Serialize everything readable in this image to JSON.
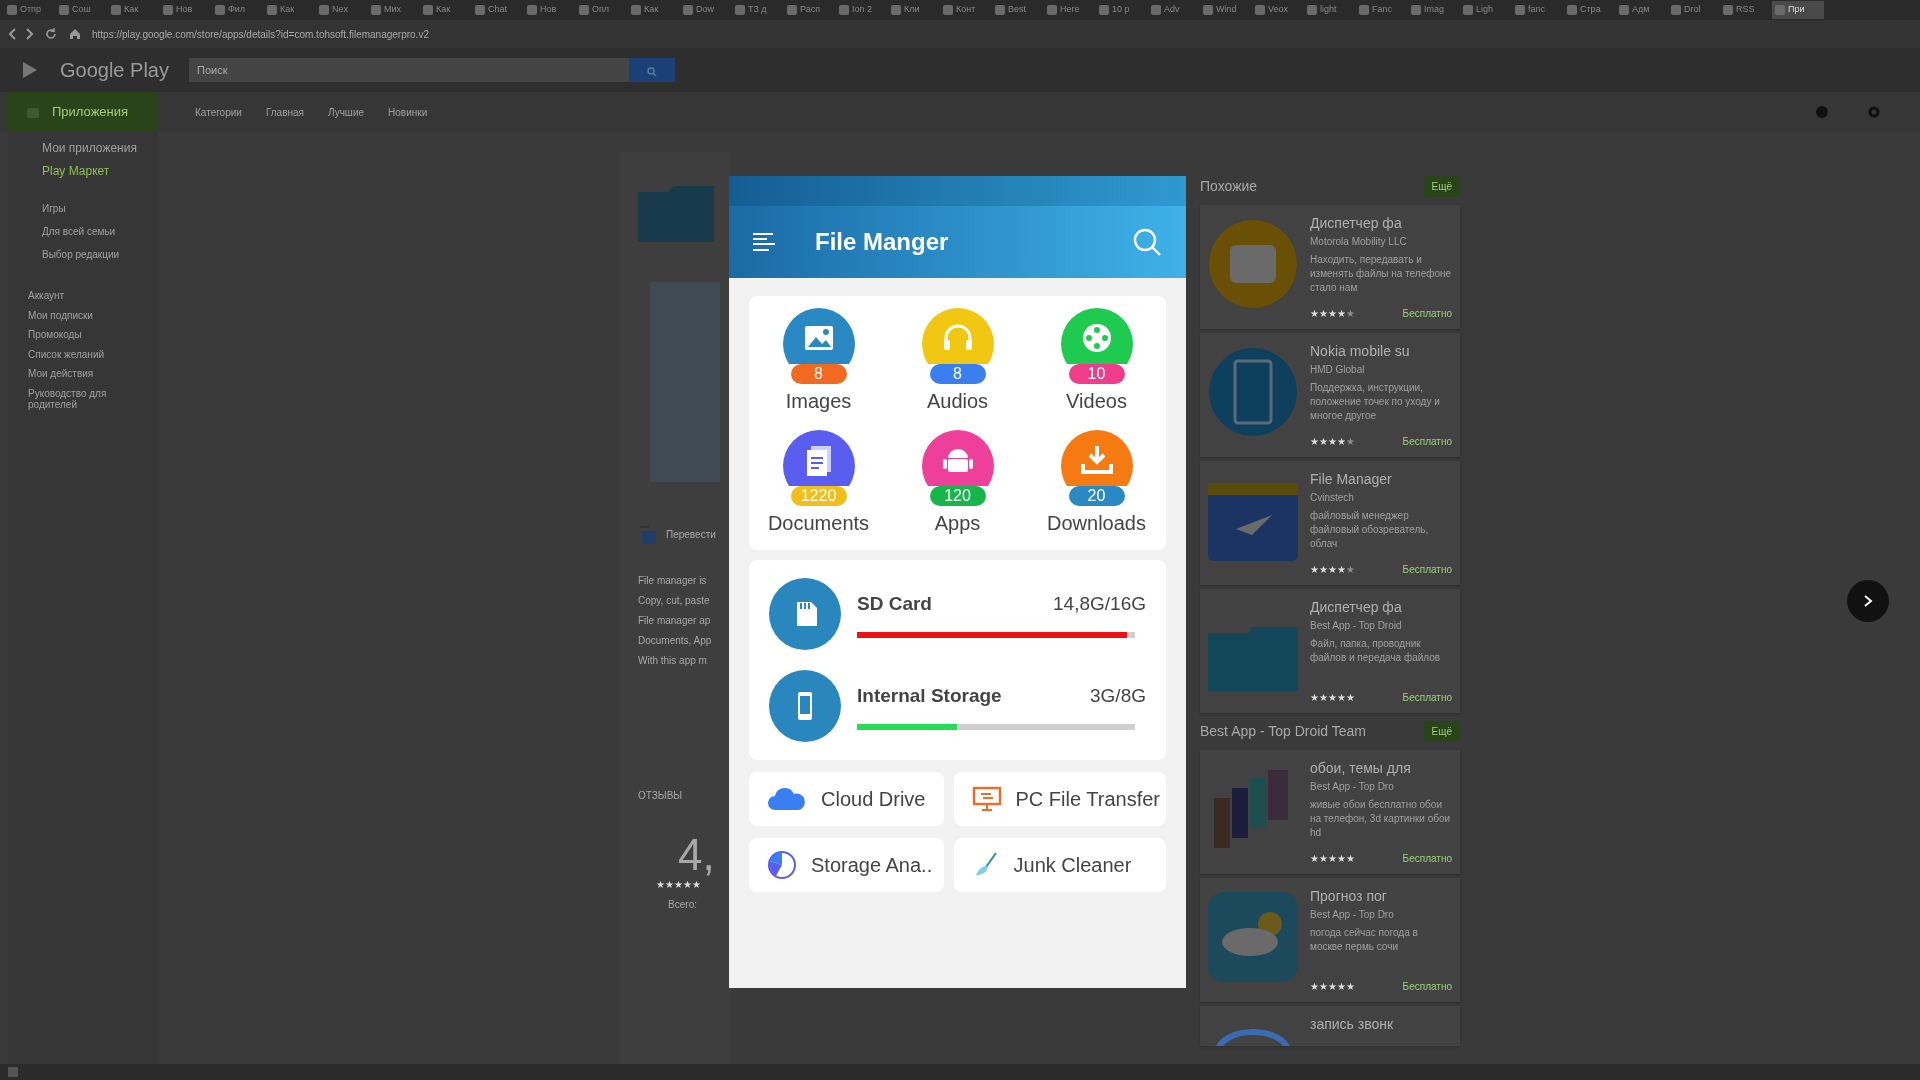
{
  "browser": {
    "tabs": [
      {
        "label": "Отпр",
        "selected": false
      },
      {
        "label": "Сош",
        "selected": false
      },
      {
        "label": "Как",
        "selected": false
      },
      {
        "label": "Нов",
        "selected": false
      },
      {
        "label": "Фил",
        "selected": false
      },
      {
        "label": "Как",
        "selected": false
      },
      {
        "label": "Nex",
        "selected": false
      },
      {
        "label": "Мих",
        "selected": false
      },
      {
        "label": "Как",
        "selected": false
      },
      {
        "label": "Chat",
        "selected": false
      },
      {
        "label": "Нов",
        "selected": false
      },
      {
        "label": "Опл",
        "selected": false
      },
      {
        "label": "Как",
        "selected": false
      },
      {
        "label": "Dow",
        "selected": false
      },
      {
        "label": "ТЗ д",
        "selected": false
      },
      {
        "label": "Расп",
        "selected": false
      },
      {
        "label": "Ion 2",
        "selected": false
      },
      {
        "label": "Кли",
        "selected": false
      },
      {
        "label": "Конт",
        "selected": false
      },
      {
        "label": "Best",
        "selected": false
      },
      {
        "label": "Here",
        "selected": false
      },
      {
        "label": "10 р",
        "selected": false
      },
      {
        "label": "Adv",
        "selected": false
      },
      {
        "label": "Wind",
        "selected": false
      },
      {
        "label": "Veox",
        "selected": false
      },
      {
        "label": "light",
        "selected": false
      },
      {
        "label": "Fanc",
        "selected": false
      },
      {
        "label": "Imag",
        "selected": false
      },
      {
        "label": "Ligh",
        "selected": false
      },
      {
        "label": "fanc",
        "selected": false
      },
      {
        "label": "Стра",
        "selected": false
      },
      {
        "label": "Адм",
        "selected": false
      },
      {
        "label": "Drol",
        "selected": false
      },
      {
        "label": "RSS",
        "selected": false
      },
      {
        "label": "При",
        "selected": true
      }
    ],
    "url": "https://play.google.com/store/apps/details?id=com.tohsoft.filemanagerpro.v2"
  },
  "store": {
    "logo": "Google Play",
    "search": {
      "placeholder": "Поиск"
    },
    "apps_button": "Приложения",
    "nav": [
      "Категории",
      "Главная",
      "Лучшие",
      "Новинки"
    ],
    "sidebar": {
      "top": [
        {
          "label": "Мои приложения",
          "selected": false
        },
        {
          "label": "Play Маркет",
          "selected": true
        }
      ],
      "sub": [
        "Игры",
        "Для всей семьи",
        "Выбор редакции"
      ],
      "account": [
        "Аккаунт",
        "Мои подписки",
        "Промокоды",
        "Список желаний",
        "Мои действия",
        "Руководство для родителей"
      ]
    },
    "details": {
      "translate": "Перевести",
      "description": [
        "File manager is",
        "Copy, cut, paste",
        "File manager ap",
        "Documents, App",
        "With this app m"
      ],
      "reviews_heading": "ОТЗЫВЫ",
      "rating": "4,",
      "stars": 5,
      "total": "Всего:"
    },
    "sections": [
      {
        "title": "Похожие",
        "more": "Ещё",
        "apps": [
          {
            "title": "Диспетчер фа",
            "developer": "Motorola Mobility LLC",
            "description": "Находить, передавать и изменять файлы на телефоне стало нам",
            "stars": 4,
            "price": "Бесплатно",
            "kind": "folder-round"
          },
          {
            "title": "Nokia mobile su",
            "developer": "HMD Global",
            "description": "Поддержка, инструкции, положение точек по уходу и многое другое",
            "stars": 4,
            "price": "Бесплатно",
            "kind": "phone"
          },
          {
            "title": "File Manager",
            "developer": "Cvinstech",
            "description": "файловый менеджер файловый обозреватель, облач",
            "stars": 4,
            "price": "Бесплатно",
            "kind": "plane"
          },
          {
            "title": "Диспетчер фа",
            "developer": "Best App - Top Droid",
            "description": "Файл, папка, проводник файлов и передача файлов",
            "stars": 5,
            "price": "Бесплатно",
            "kind": "folder"
          }
        ]
      },
      {
        "title": "Best App - Top Droid Team",
        "more": "Ещё",
        "apps": [
          {
            "title": "обои, темы для",
            "developer": "Best App - Top Dro",
            "description": "живые обои бесплатно обои на телефон, 3d картинки обои hd",
            "stars": 5,
            "price": "Бесплатно",
            "kind": "wallpapers"
          },
          {
            "title": "Прогноз пог",
            "developer": "Best App - Top Dro",
            "description": "погода сейчас погода в москве пермь сочи",
            "stars": 5,
            "price": "Бесплатно",
            "kind": "weather"
          },
          {
            "title": "запись звонк",
            "kind": "partial"
          }
        ]
      }
    ]
  },
  "viewer": {
    "title": "File Manger",
    "categories": [
      {
        "label": "Images",
        "color": "#2a88c2",
        "kind": "image",
        "badge": {
          "text": "8",
          "color": "#f26a22"
        }
      },
      {
        "label": "Audios",
        "color": "#f2c712",
        "kind": "audio",
        "badge": {
          "text": "8",
          "color": "#3a7ff0"
        }
      },
      {
        "label": "Videos",
        "color": "#1fcb4f",
        "kind": "video",
        "badge": {
          "text": "10",
          "color": "#ef3d8c"
        }
      },
      {
        "label": "Documents",
        "color": "#5a5ef0",
        "kind": "document",
        "badge": {
          "text": "1220",
          "color": "#f2be1a"
        }
      },
      {
        "label": "Apps",
        "color": "#ee3f9a",
        "kind": "android",
        "badge": {
          "text": "120",
          "color": "#17b64a"
        }
      },
      {
        "label": "Downloads",
        "color": "#f57a12",
        "kind": "download",
        "badge": {
          "text": "20",
          "color": "#2a88c2"
        }
      }
    ],
    "storages": [
      {
        "name": "SD Card",
        "reading": "14,8G/16G",
        "level": 0.97,
        "color": "#ee1111",
        "kind": "sdcard"
      },
      {
        "name": "Internal Storage",
        "reading": "3G/8G",
        "level": 0.36,
        "color": "#22dd55",
        "kind": "phone"
      }
    ],
    "tools": [
      {
        "label": "Cloud Drive",
        "kind": "cloud"
      },
      {
        "label": "PC File Transfer",
        "kind": "pc"
      },
      {
        "label": "Storage Ana..",
        "kind": "pie"
      },
      {
        "label": "Junk Cleaner",
        "kind": "broom"
      }
    ]
  }
}
